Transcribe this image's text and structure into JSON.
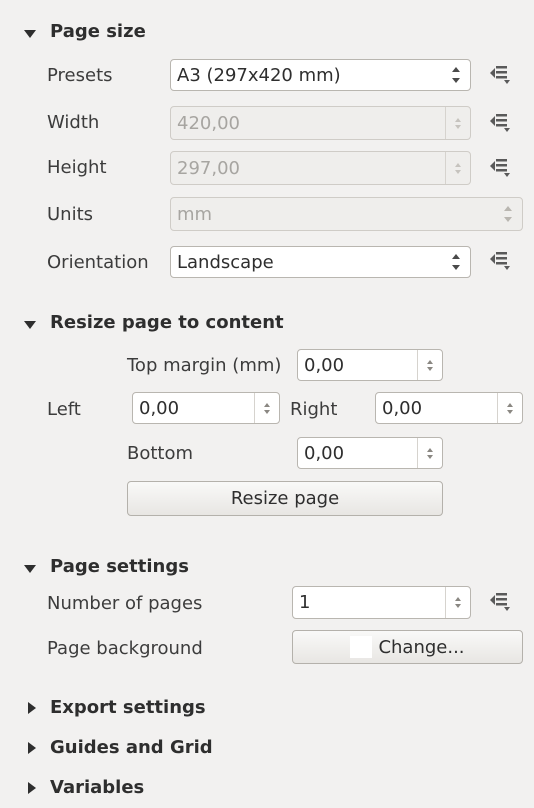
{
  "page_size": {
    "title": "Page size",
    "presets_label": "Presets",
    "presets_value": "A3 (297x420 mm)",
    "width_label": "Width",
    "width_value": "420,00",
    "height_label": "Height",
    "height_value": "297,00",
    "units_label": "Units",
    "units_value": "mm",
    "orientation_label": "Orientation",
    "orientation_value": "Landscape"
  },
  "resize": {
    "title": "Resize page to content",
    "top_label": "Top margin (mm)",
    "top_value": "0,00",
    "left_label": "Left",
    "left_value": "0,00",
    "right_label": "Right",
    "right_value": "0,00",
    "bottom_label": "Bottom",
    "bottom_value": "0,00",
    "resize_button": "Resize page"
  },
  "page_settings": {
    "title": "Page settings",
    "num_pages_label": "Number of pages",
    "num_pages_value": "1",
    "background_label": "Page background",
    "change_button": "Change..."
  },
  "collapsed": {
    "export": "Export settings",
    "guides": "Guides and Grid",
    "variables": "Variables"
  },
  "icons": {
    "data_defined": "data-defined-override-icon"
  }
}
